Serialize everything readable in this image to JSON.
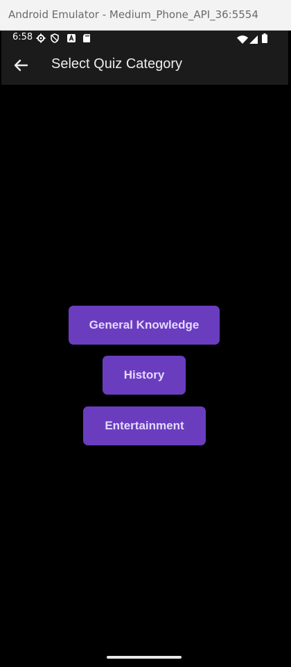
{
  "emulator": {
    "title": "Android Emulator - Medium_Phone_API_36:5554"
  },
  "status_bar": {
    "time": "6:58",
    "left_icons": [
      "gear-icon",
      "shield-icon",
      "a-box-icon",
      "sd-card-icon"
    ],
    "right_icons": [
      "wifi-icon",
      "signal-icon",
      "battery-icon"
    ]
  },
  "app_bar": {
    "title": "Select Quiz Category",
    "back_icon": "arrow-left-icon"
  },
  "categories": [
    "General Knowledge",
    "History",
    "Entertainment"
  ],
  "colors": {
    "button_bg": "#6a3dbf",
    "button_text": "#e6d9ff",
    "app_bar_bg": "#1b1b1b",
    "screen_bg": "#000000"
  }
}
